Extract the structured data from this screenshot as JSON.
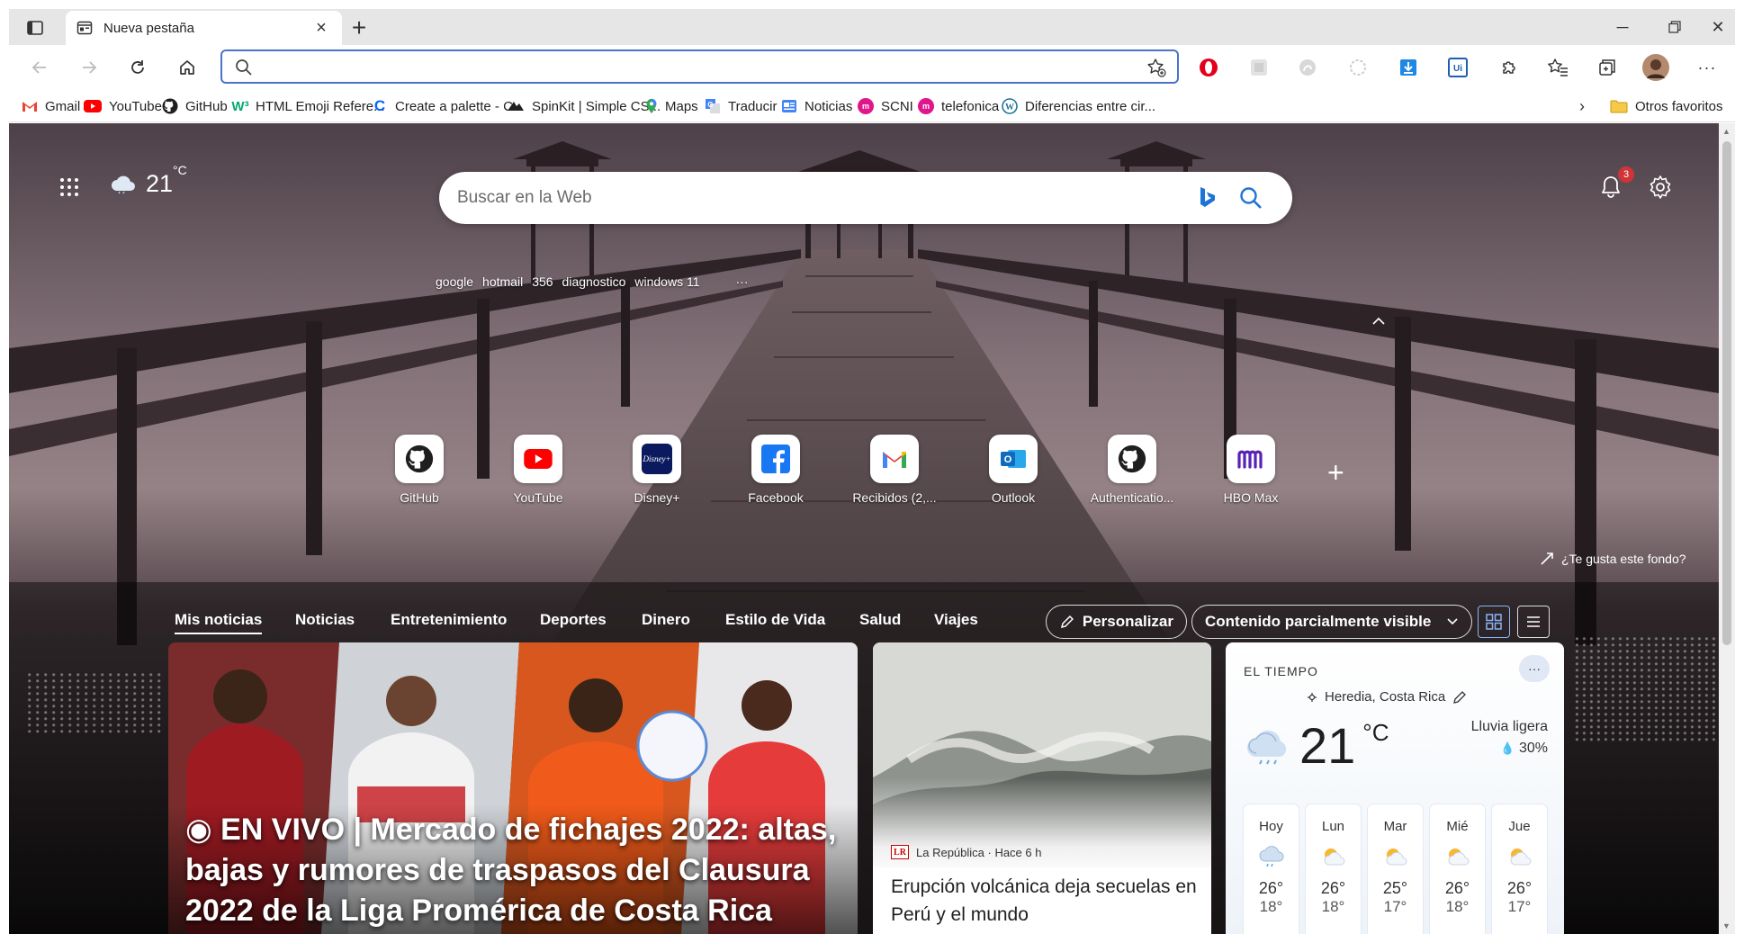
{
  "browser": {
    "tab_title": "Nueva pestaña",
    "address_value": "",
    "address_placeholder": "",
    "bookmarks": [
      {
        "label": "Gmail",
        "icon": "gmail-icon"
      },
      {
        "label": "YouTube",
        "icon": "youtube-icon"
      },
      {
        "label": "GitHub",
        "icon": "github-icon"
      },
      {
        "label": "HTML Emoji Refere...",
        "icon": "w3schools-icon"
      },
      {
        "label": "Create a palette - C...",
        "icon": "coolors-icon"
      },
      {
        "label": "SpinKit | Simple CS...",
        "icon": "spinkit-icon"
      },
      {
        "label": "Maps",
        "icon": "maps-icon"
      },
      {
        "label": "Traducir",
        "icon": "translate-icon"
      },
      {
        "label": "Noticias",
        "icon": "news-icon"
      },
      {
        "label": "SCNI",
        "icon": "scni-icon"
      },
      {
        "label": "telefonica",
        "icon": "telefonica-icon"
      },
      {
        "label": "Diferencias entre cir...",
        "icon": "wordpress-icon"
      }
    ],
    "other_favorites": "Otros favoritos"
  },
  "page": {
    "weather_mini": {
      "temp": "21",
      "unit": "°C"
    },
    "notification_count": "3",
    "search_placeholder": "Buscar en la Web",
    "trending": [
      "google",
      "hotmail",
      "356",
      "diagnostico",
      "windows 11"
    ],
    "quicklinks": [
      {
        "label": "GitHub",
        "icon": "github-icon"
      },
      {
        "label": "YouTube",
        "icon": "youtube-icon"
      },
      {
        "label": "Disney+",
        "icon": "disney-icon"
      },
      {
        "label": "Facebook",
        "icon": "facebook-icon"
      },
      {
        "label": "Recibidos (2,...",
        "icon": "gmail-icon"
      },
      {
        "label": "Outlook",
        "icon": "outlook-icon"
      },
      {
        "label": "Authenticatio...",
        "icon": "github-icon"
      },
      {
        "label": "HBO Max",
        "icon": "hbomax-icon"
      }
    ],
    "like_background": "¿Te gusta este fondo?",
    "nav": {
      "items": [
        "Mis noticias",
        "Noticias",
        "Entretenimiento",
        "Deportes",
        "Dinero",
        "Estilo de Vida",
        "Salud",
        "Viajes"
      ],
      "personalize": "Personalizar",
      "content_visibility": "Contenido parcialmente visible"
    },
    "hero": {
      "live_marker": "◉",
      "headline": "EN VIVO | Mercado de fichajes 2022: altas, bajas y rumores de traspasos del Clausura 2022 de la Liga Promérica de Costa Rica"
    },
    "card2": {
      "source_logo": "LR",
      "source": "La República · Hace 6 h",
      "title": "Erupción volcánica deja secuelas en Perú y el mundo"
    },
    "weather": {
      "header": "EL TIEMPO",
      "location": "Heredia, Costa Rica",
      "temp": "21",
      "unit": "°C",
      "condition": "Lluvia ligera",
      "precip": "30%",
      "days": [
        {
          "name": "Hoy",
          "hi": "26°",
          "lo": "18°",
          "icon": "rain-cloud-icon"
        },
        {
          "name": "Lun",
          "hi": "26°",
          "lo": "18°",
          "icon": "partly-sunny-icon"
        },
        {
          "name": "Mar",
          "hi": "25°",
          "lo": "17°",
          "icon": "partly-sunny-icon"
        },
        {
          "name": "Mié",
          "hi": "26°",
          "lo": "18°",
          "icon": "partly-sunny-icon"
        },
        {
          "name": "Jue",
          "hi": "26°",
          "lo": "17°",
          "icon": "partly-sunny-icon"
        }
      ]
    }
  },
  "colors": {
    "accent": "#4a74c9",
    "badge": "#d13438",
    "youtube": "#ff0000",
    "facebook": "#1877f2",
    "hbomax": "#5822b4"
  }
}
